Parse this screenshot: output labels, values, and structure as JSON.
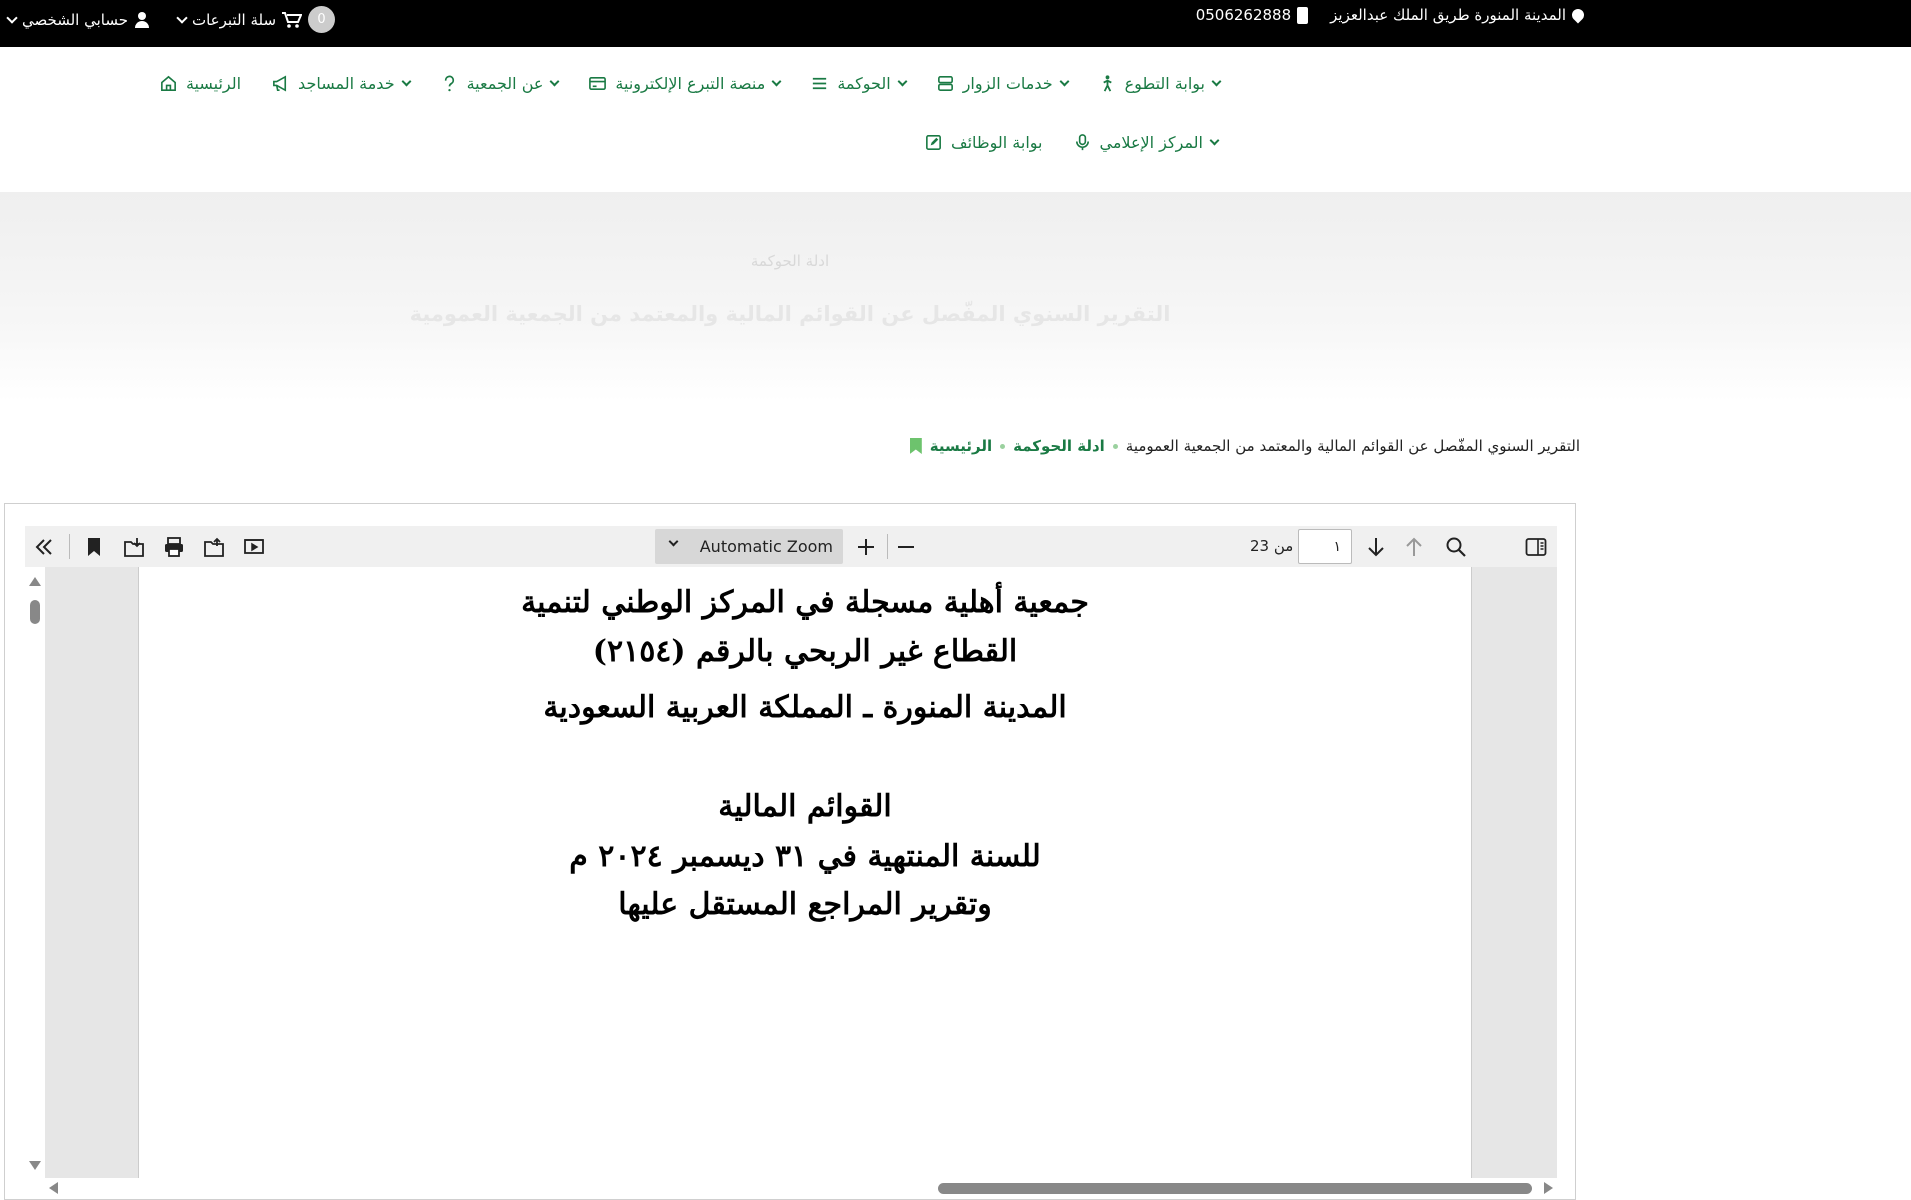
{
  "topbar": {
    "phone": "0506262888",
    "address": "المدينة المنورة طريق الملك عبدالعزيز",
    "cart_count": "0",
    "cart_label": "سلة التبرعات",
    "account_label": "حسابي الشخصي"
  },
  "nav": {
    "row1": [
      {
        "label": "الرئيسية",
        "icon": "home-icon",
        "dropdown": false
      },
      {
        "label": "خدمة المساجد",
        "icon": "megaphone-icon",
        "dropdown": true
      },
      {
        "label": "عن الجمعية",
        "icon": "question-icon",
        "dropdown": true
      },
      {
        "label": "منصة التبرع الإلكترونية",
        "icon": "card-icon",
        "dropdown": true
      },
      {
        "label": "الحوكمة",
        "icon": "list-icon",
        "dropdown": true
      },
      {
        "label": "خدمات الزوار",
        "icon": "server-icon",
        "dropdown": true
      },
      {
        "label": "بوابة التطوع",
        "icon": "person-icon",
        "dropdown": true
      }
    ],
    "row2": [
      {
        "label": "بوابة الوظائف",
        "icon": "edit-icon",
        "dropdown": false
      },
      {
        "label": "المركز الإعلامي",
        "icon": "microphone-icon",
        "dropdown": true
      }
    ]
  },
  "hero": {
    "subtitle": "ادلة الحوكمة",
    "title": "التقرير السنوي المفّصل عن القوائم المالية والمعتمد من الجمعية العمومية"
  },
  "breadcrumb": {
    "home": "الرئيسية",
    "section": "ادلة الحوكمة",
    "current": "التقرير السنوي المفّصل عن القوائم المالية والمعتمد من الجمعية العمومية"
  },
  "viewer": {
    "zoom_label": "Automatic Zoom",
    "page_value": "١",
    "page_total": "من 23",
    "lines": [
      "جمعية أهلية مسجلة في المركز الوطني لتنمية",
      "القطاع غير الربحي بالرقم (٢١٥٤)",
      "المدينة المنورة ـ المملكة العربية السعودية",
      "القوائم المالية",
      "للسنة المنتهية في ٣١ ديسمبر ٢٠٢٤ م",
      "وتقرير المراجع المستقل عليها"
    ]
  }
}
